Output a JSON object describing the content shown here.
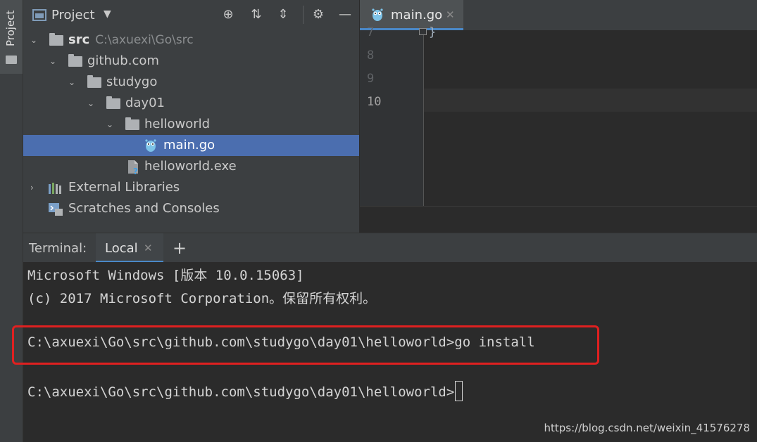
{
  "sidebar": {
    "project_tab_label": "Project"
  },
  "project": {
    "title": "Project",
    "tree": [
      {
        "label": "src",
        "path": "C:\\axuexi\\Go\\src",
        "bold": true
      },
      {
        "label": "github.com"
      },
      {
        "label": "studygo"
      },
      {
        "label": "day01"
      },
      {
        "label": "helloworld"
      },
      {
        "label": "main.go",
        "selected": true
      },
      {
        "label": "helloworld.exe"
      },
      {
        "label": "External Libraries"
      },
      {
        "label": "Scratches and Consoles"
      }
    ]
  },
  "editor": {
    "tab_label": "main.go",
    "code_fragment": "}",
    "line_numbers": [
      "7",
      "8",
      "9",
      "10"
    ]
  },
  "terminal": {
    "title": "Terminal:",
    "tab_label": "Local",
    "lines": [
      "Microsoft Windows [版本 10.0.15063]",
      "(c) 2017 Microsoft Corporation。保留所有权利。",
      "C:\\axuexi\\Go\\src\\github.com\\studygo\\day01\\helloworld>go install",
      "C:\\axuexi\\Go\\src\\github.com\\studygo\\day01\\helloworld>"
    ]
  },
  "watermark": "https://blog.csdn.net/weixin_41576278",
  "colors": {
    "selection": "#4b6eaf",
    "accent": "#4a88c7",
    "highlight_box": "#e02020"
  }
}
